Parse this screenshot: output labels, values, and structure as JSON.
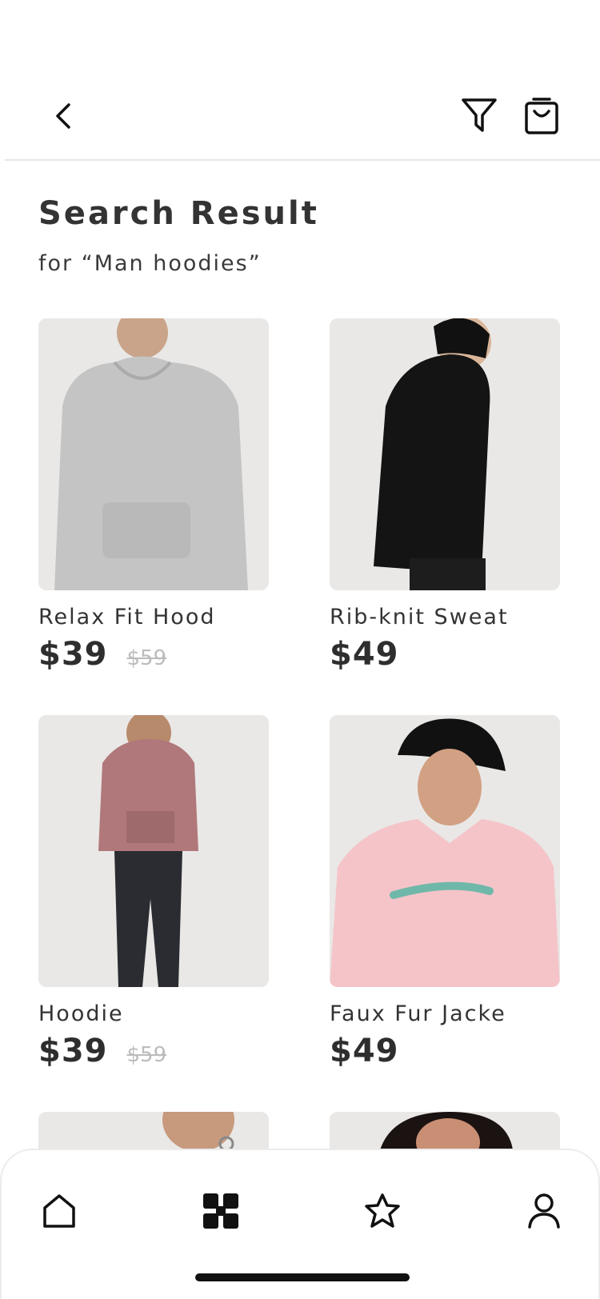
{
  "header": {
    "back_icon": "chevron-left-icon",
    "filter_icon": "filter-icon",
    "cart_icon": "shopping-bag-icon"
  },
  "page": {
    "title": "Search Result",
    "subtitle": "for “Man hoodies”"
  },
  "products": [
    {
      "name": "Relax Fit Hood",
      "price": "$39",
      "old_price": "$59",
      "image_color": "#c4c4c4"
    },
    {
      "name": "Rib-knit Sweat",
      "price": "$49",
      "old_price": "",
      "image_color": "#141414"
    },
    {
      "name": "Hoodie",
      "price": "$39",
      "old_price": "$59",
      "image_color": "#b0787a"
    },
    {
      "name": "Faux Fur Jacke",
      "price": "$49",
      "old_price": "",
      "image_color": "#f5c4c9"
    }
  ],
  "bottom_nav": {
    "items": [
      {
        "icon": "home-icon",
        "active": false
      },
      {
        "icon": "grid-icon",
        "active": true
      },
      {
        "icon": "star-icon",
        "active": false
      },
      {
        "icon": "profile-icon",
        "active": false
      }
    ]
  },
  "colors": {
    "text": "#2e2e2e",
    "muted": "#bcbcbc",
    "image_bg": "#e9e8e6"
  }
}
